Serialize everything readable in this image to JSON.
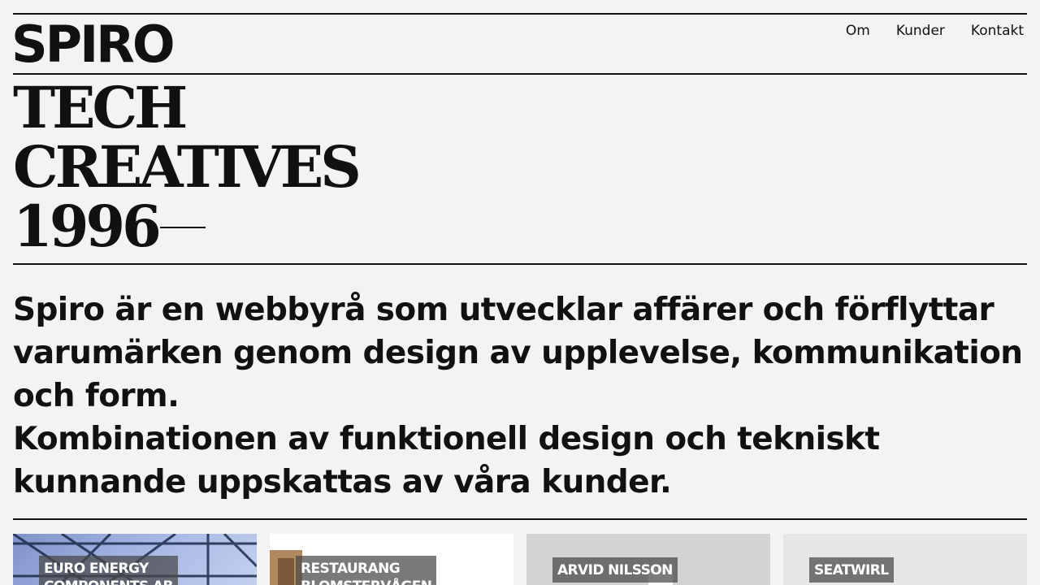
{
  "header": {
    "logo": "SPIRO",
    "nav": [
      "Om",
      "Kunder",
      "Kontakt"
    ]
  },
  "hero": {
    "line1": "TECH",
    "line2": "CREATIVES",
    "line3": "1996"
  },
  "intro": {
    "paragraph1": "Spiro är en webbyrå som utvecklar affärer och förflyttar varumärken genom design av upplevelse, kommunikation och form.",
    "paragraph2": "Kombinationen av funktionell design och tekniskt kunnande uppskattas av våra kunder."
  },
  "cards": [
    {
      "title": "EURO ENERGY\nCOMPONENTS AB"
    },
    {
      "title": "RESTAURANG\nBLOMSTERVÅGEN"
    },
    {
      "title": "ARVID NILSSON"
    },
    {
      "title": "SEATWIRL"
    }
  ],
  "colors": {
    "background": "#f3f3f1",
    "text": "#111111",
    "tag_background": "#464646"
  }
}
